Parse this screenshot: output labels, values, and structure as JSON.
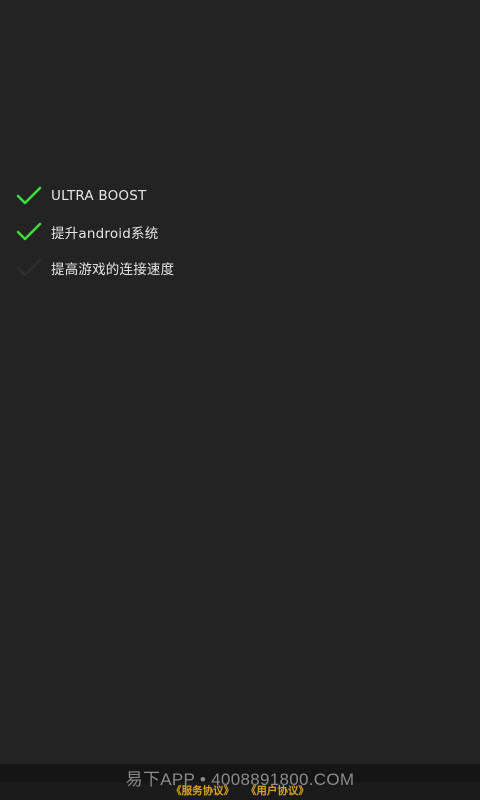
{
  "colors": {
    "background": "#232323",
    "check_active": "#3ddc3d",
    "check_inactive": "#2e2e2e",
    "link": "#d9a21f"
  },
  "checklist": {
    "items": [
      {
        "label": "ULTRA BOOST",
        "checked": true,
        "icon": "check-icon"
      },
      {
        "label": "提升android系统",
        "checked": true,
        "icon": "check-icon"
      },
      {
        "label": "提高游戏的连接速度",
        "checked": false,
        "icon": "check-icon"
      }
    ]
  },
  "footer": {
    "watermark": "易下APP • 4008891800.COM",
    "service_agreement": "《服务协议》",
    "user_agreement": "《用户协议》"
  }
}
